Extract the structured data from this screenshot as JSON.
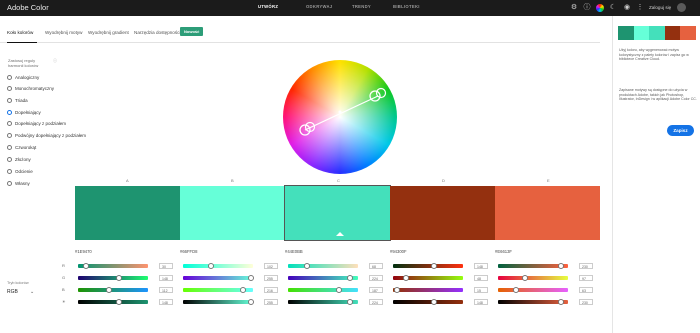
{
  "topbar": {
    "brand": "Adobe Color",
    "nav": [
      {
        "label": "UTWÓRZ",
        "active": true
      },
      {
        "label": "ODKRYWAJ",
        "active": false
      },
      {
        "label": "TRENDY",
        "active": false
      },
      {
        "label": "BIBLIOTEKI",
        "active": false
      }
    ],
    "login": "Zaloguj się"
  },
  "tabs": [
    {
      "label": "Koło kolorów",
      "active": true
    },
    {
      "label": "Wyodrębnij motyw",
      "active": false
    },
    {
      "label": "Wyodrębnij gradient",
      "active": false
    },
    {
      "label": "Narzędzia dostępności",
      "active": false
    }
  ],
  "new_badge": "Nowość",
  "rules": {
    "title": "Zastosuj reguły harmonii kolorów",
    "info_icon": "ⓘ",
    "items": [
      {
        "label": "Analogiczny",
        "selected": false
      },
      {
        "label": "Monochromatyczny",
        "selected": false
      },
      {
        "label": "Triada",
        "selected": false
      },
      {
        "label": "Dopełniający",
        "selected": true
      },
      {
        "label": "Dopełniający z podziałem",
        "selected": false
      },
      {
        "label": "Podwójny dopełniający z podziałem",
        "selected": false
      },
      {
        "label": "Czworokąt",
        "selected": false
      },
      {
        "label": "Złożony",
        "selected": false
      },
      {
        "label": "Odcienie",
        "selected": false
      },
      {
        "label": "Własny",
        "selected": false
      }
    ]
  },
  "color_mode": {
    "label": "Tryb kolorów",
    "value": "RGB"
  },
  "swatches": [
    {
      "letter": "A",
      "hex": "#1E9470",
      "color": "#1E9470",
      "selected": false
    },
    {
      "letter": "B",
      "hex": "#66FFD8",
      "color": "#66FFD8",
      "selected": false
    },
    {
      "letter": "C",
      "hex": "#44E0BB",
      "color": "#44E0BB",
      "selected": true
    },
    {
      "letter": "D",
      "hex": "#94300F",
      "color": "#94300F",
      "selected": false
    },
    {
      "letter": "E",
      "hex": "#E6613F",
      "color": "#E6613F",
      "selected": false
    }
  ],
  "channels": [
    "R",
    "G",
    "B",
    "☀"
  ],
  "slider_values": [
    [
      "30",
      "148",
      "112",
      "148"
    ],
    [
      "102",
      "255",
      "216",
      "255"
    ],
    [
      "68",
      "224",
      "187",
      "224"
    ],
    [
      "148",
      "48",
      "15",
      "148"
    ],
    [
      "230",
      "97",
      "63",
      "230"
    ]
  ],
  "right_panel": {
    "swatches": [
      "#1E9470",
      "#66FFD8",
      "#44E0BB",
      "#94300F",
      "#E6613F"
    ],
    "text1": "Użyj koloru, aby wygenerować motyw kolorystyczny z palety kolorów i zapisz go w bibliotece Creative Cloud.",
    "text2": "Zapisane motywy są dostępne do użycia w produktach Adobe, takich jak Photoshop, Illustrator, InDesign i w aplikacji Adobe Color CC.",
    "save": "Zapisz"
  }
}
